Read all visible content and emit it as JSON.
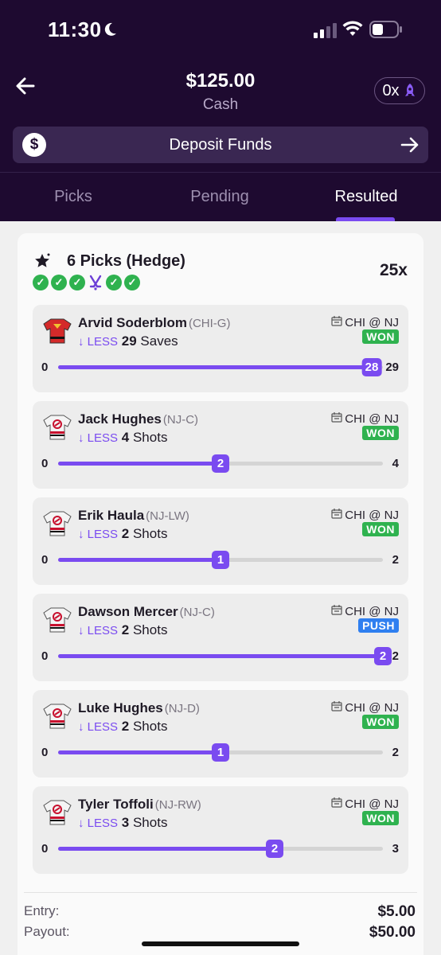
{
  "status_bar": {
    "time": "11:30"
  },
  "header": {
    "balance": "$125.00",
    "balance_label": "Cash",
    "multiplier_pill": "0x",
    "deposit_label": "Deposit Funds"
  },
  "tabs": [
    {
      "label": "Picks",
      "active": false
    },
    {
      "label": "Pending",
      "active": false
    },
    {
      "label": "Resulted",
      "active": true
    }
  ],
  "entry": {
    "title": "6 Picks (Hedge)",
    "multiplier": "25x",
    "checks": [
      "check",
      "check",
      "check",
      "hockey-sticks",
      "check",
      "check"
    ],
    "entry_label": "Entry:",
    "entry_value": "$5.00",
    "payout_label": "Payout:",
    "payout_value": "$50.00"
  },
  "picks": [
    {
      "name": "Arvid Soderblom",
      "team": "(CHI-G)",
      "direction": "LESS",
      "line": "29",
      "stat": "Saves",
      "game": "CHI @ NJ",
      "result": "WON",
      "min": "0",
      "max": "29",
      "actual": "28",
      "actual_num": 28,
      "max_num": 29,
      "jersey": "chi"
    },
    {
      "name": "Jack Hughes",
      "team": "(NJ-C)",
      "direction": "LESS",
      "line": "4",
      "stat": "Shots",
      "game": "CHI @ NJ",
      "result": "WON",
      "min": "0",
      "max": "4",
      "actual": "2",
      "actual_num": 2,
      "max_num": 4,
      "jersey": "nj"
    },
    {
      "name": "Erik Haula",
      "team": "(NJ-LW)",
      "direction": "LESS",
      "line": "2",
      "stat": "Shots",
      "game": "CHI @ NJ",
      "result": "WON",
      "min": "0",
      "max": "2",
      "actual": "1",
      "actual_num": 1,
      "max_num": 2,
      "jersey": "nj"
    },
    {
      "name": "Dawson Mercer",
      "team": "(NJ-C)",
      "direction": "LESS",
      "line": "2",
      "stat": "Shots",
      "game": "CHI @ NJ",
      "result": "PUSH",
      "min": "0",
      "max": "2",
      "actual": "2",
      "actual_num": 2,
      "max_num": 2,
      "jersey": "nj"
    },
    {
      "name": "Luke Hughes",
      "team": "(NJ-D)",
      "direction": "LESS",
      "line": "2",
      "stat": "Shots",
      "game": "CHI @ NJ",
      "result": "WON",
      "min": "0",
      "max": "2",
      "actual": "1",
      "actual_num": 1,
      "max_num": 2,
      "jersey": "nj"
    },
    {
      "name": "Tyler Toffoli",
      "team": "(NJ-RW)",
      "direction": "LESS",
      "line": "3",
      "stat": "Shots",
      "game": "CHI @ NJ",
      "result": "WON",
      "min": "0",
      "max": "3",
      "actual": "2",
      "actual_num": 2,
      "max_num": 3,
      "jersey": "nj"
    }
  ],
  "colors": {
    "accent": "#7a4bf0",
    "header_bg": "#1e0a30",
    "won": "#2fb24f",
    "push": "#2f7ff0"
  }
}
